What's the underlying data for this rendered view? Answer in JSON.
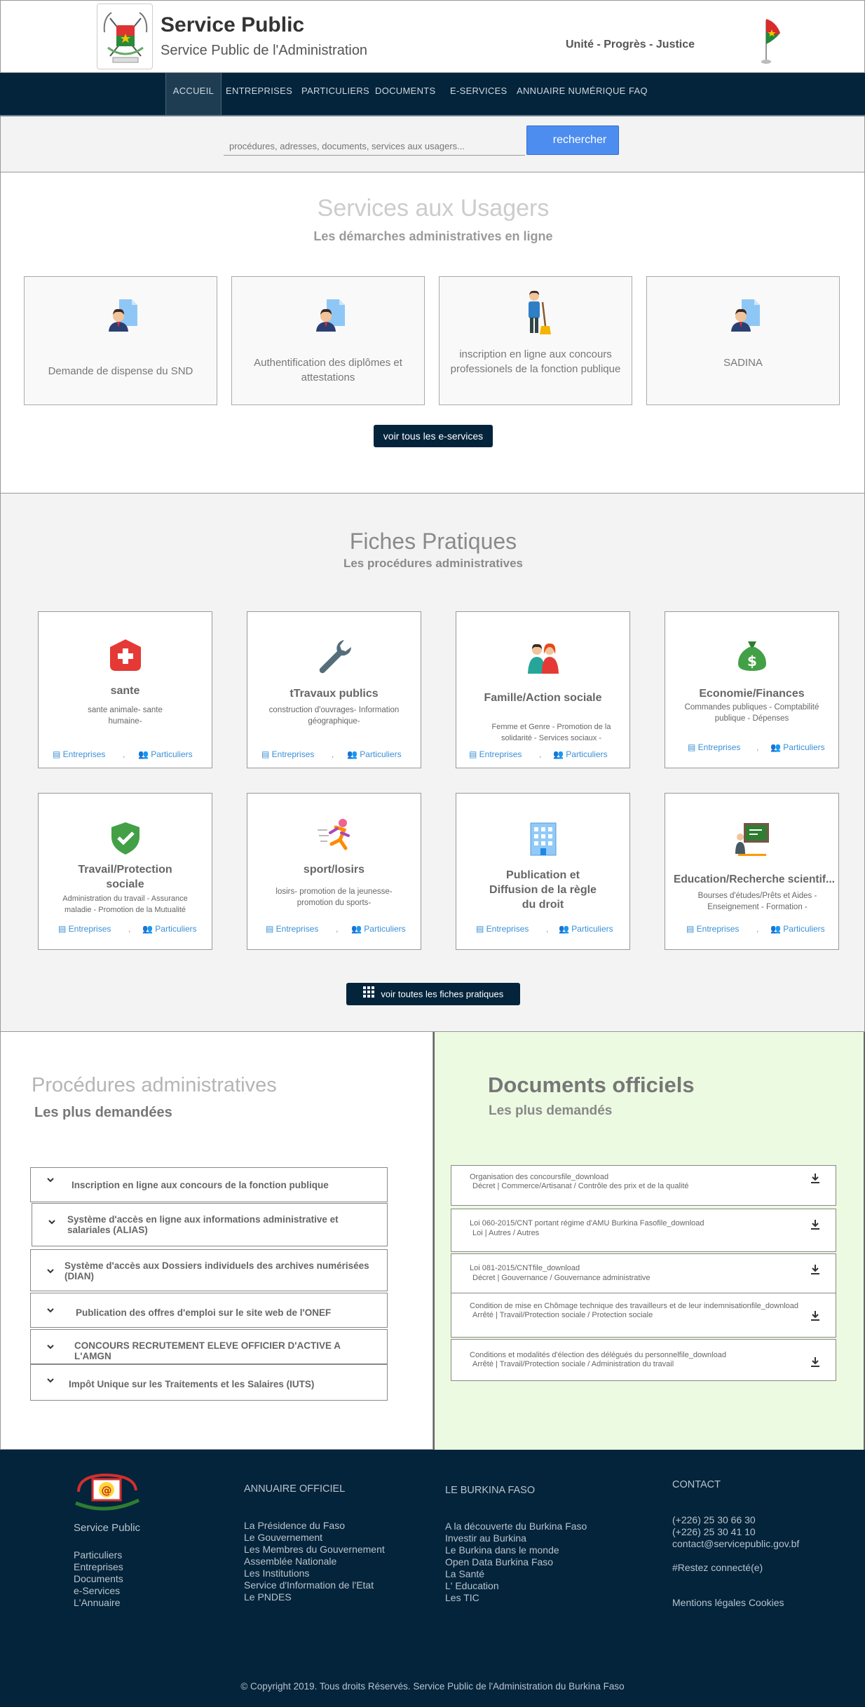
{
  "header": {
    "title": "Service Public",
    "subtitle": "Service Public de l'Administration",
    "motto": "Unité - Progrès - Justice"
  },
  "nav": {
    "items": [
      "ACCUEIL",
      "ENTREPRISES",
      "PARTICULIERS",
      "DOCUMENTS",
      "E-SERVICES",
      "ANNUAIRE NUMÉRIQUE",
      "FAQ"
    ],
    "active": "ACCUEIL"
  },
  "search": {
    "placeholder": "procédures, adresses, documents, services aux usagers...",
    "button": "rechercher"
  },
  "services": {
    "title": "Services aux Usagers",
    "subtitle": "Les démarches administratives en ligne",
    "cards": [
      {
        "label": "Demande de dispense du SND",
        "icon": "person-document-icon"
      },
      {
        "label": "Authentification des diplômes et attestations",
        "icon": "person-document-icon"
      },
      {
        "label": "inscription en ligne aux concours professionels de la fonction publique",
        "icon": "worker-broom-icon"
      },
      {
        "label": "SADINA",
        "icon": "person-document-icon"
      }
    ],
    "all_button": "voir tous les e-services"
  },
  "fiches": {
    "title": "Fiches Pratiques",
    "subtitle": "Les procédures administratives",
    "link_entreprises": "Entreprises",
    "link_particuliers": "Particuliers",
    "separator": ",",
    "cards": [
      {
        "title": "sante",
        "desc": "sante animale- sante humaine-",
        "icon": "health-cross-icon"
      },
      {
        "title": "tTravaux publics",
        "desc": "construction d'ouvrages- Information géographique-",
        "icon": "wrench-icon"
      },
      {
        "title": "Famille/Action sociale",
        "desc": "Femme et Genre - Promotion de la solidarité - Services sociaux -",
        "icon": "family-icon"
      },
      {
        "title": "Economie/Finances",
        "desc": "Commandes publiques - Comptabilité publique - Dépenses",
        "icon": "money-bag-icon"
      },
      {
        "title": "Travail/Protection sociale",
        "desc": "Administration du travail - Assurance maladie - Promotion de la Mutualité",
        "icon": "shield-check-icon"
      },
      {
        "title": "sport/losirs",
        "desc": "losirs- promotion de la jeunesse- promotion du sports-",
        "icon": "runner-icon"
      },
      {
        "title": "Publication et Diffusion de la règle du droit",
        "desc": "",
        "icon": "building-icon"
      },
      {
        "title": "Education/Recherche scientif...",
        "desc": "Bourses d'études/Prêts et Aides - Enseignement - Formation -",
        "icon": "teacher-board-icon"
      }
    ],
    "all_button": "voir toutes  les fiches pratiques"
  },
  "procedures": {
    "title": "Procédures administratives",
    "subtitle": "Les plus demandées",
    "items": [
      "Inscription en ligne aux concours de la fonction publique",
      "Système d'accès en ligne aux informations administrative et salariales (ALIAS)",
      "Système d'accès aux Dossiers individuels des archives numérisées (DIAN)",
      "Publication des offres d'emploi sur le site web de l'ONEF",
      "CONCOURS RECRUTEMENT ELEVE OFFICIER D'ACTIVE A L'AMGN",
      "Impôt Unique sur les Traitements et les Salaires (IUTS)"
    ]
  },
  "documents": {
    "title": "Documents officiels",
    "subtitle": "Les plus demandés",
    "items": [
      {
        "title": "Organisation des concoursfile_download",
        "meta": "Décret | Commerce/Artisanat / Contrôle des prix et de la qualité"
      },
      {
        "title": "Loi 060-2015/CNT portant régime d'AMU Burkina Fasofile_download",
        "meta": "Loi | Autres / Autres"
      },
      {
        "title": "Loi 081-2015/CNTfile_download",
        "meta": "Décret | Gouvernance / Gouvernance administrative"
      },
      {
        "title": "Condition de mise en Chômage technique des travailleurs et de leur indemnisationfile_download",
        "meta": "Arrêté | Travail/Protection sociale / Protection sociale"
      },
      {
        "title": "Conditions et modalités d'élection des délégués du personnelfile_download",
        "meta": "Arrêté | Travail/Protection sociale / Administration du travail"
      }
    ]
  },
  "footer": {
    "brand": "Service Public",
    "brand_links": [
      "Particuliers",
      "Entreprises",
      "Documents",
      "e-Services",
      "L'Annuaire"
    ],
    "annuaire_title": "ANNUAIRE OFFICIEL",
    "annuaire_links": [
      "La Présidence du Faso",
      "Le Gouvernement",
      "Les Membres du Gouvernement",
      "Assemblée Nationale",
      "Les Institutions",
      "Service d'Information de l'Etat",
      "Le PNDES"
    ],
    "burkina_title": "LE BURKINA FASO",
    "burkina_links": [
      "A la découverte du Burkina Faso",
      "Investir au Burkina",
      "Le Burkina dans le monde",
      "Open Data Burkina Faso",
      "La Santé",
      "L' Education",
      "Les TIC"
    ],
    "contact_title": "CONTACT",
    "contact_lines": [
      "(+226) 25 30 66 30",
      "(+226) 25 30 41 10",
      "contact@servicepublic.gov.bf"
    ],
    "hashtag": "#Restez connecté(e)",
    "legal": "Mentions légales Cookies",
    "copyright": "© Copyright 2019. Tous droits Réservés. Service Public de l'Administration du Burkina Faso"
  },
  "colors": {
    "navy": "#03243b",
    "accent_blue": "#4d8df0",
    "link_blue": "#3a8fd6",
    "docs_bg": "#ecfae2"
  }
}
